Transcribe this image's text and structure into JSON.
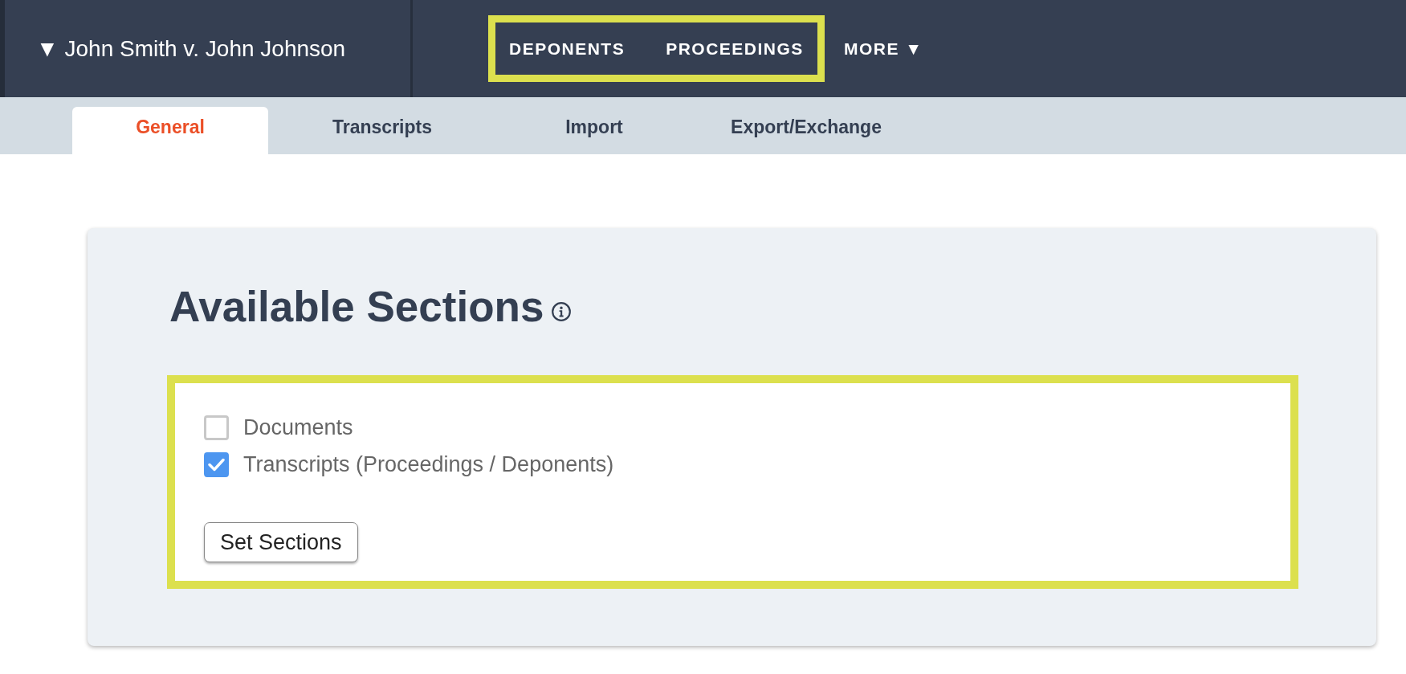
{
  "header": {
    "case_title": "▼ John Smith v. John Johnson",
    "nav_groups": [
      {
        "highlighted": true,
        "items": [
          {
            "label": "DEPONENTS"
          },
          {
            "label": "PROCEEDINGS"
          }
        ]
      },
      {
        "highlighted": false,
        "items": [
          {
            "label": "MORE ▼"
          }
        ]
      }
    ]
  },
  "tabs": [
    {
      "label": "General",
      "selected": true
    },
    {
      "label": "Transcripts",
      "selected": false
    },
    {
      "label": "Import",
      "selected": false
    },
    {
      "label": "Export/Exchange",
      "selected": false
    }
  ],
  "card": {
    "title": "Available Sections",
    "panel": {
      "highlighted": true,
      "options": [
        {
          "label": "Documents",
          "checked": false
        },
        {
          "label": "Transcripts (Proceedings / Deponents)",
          "checked": true
        }
      ],
      "button": "Set Sections"
    }
  }
}
